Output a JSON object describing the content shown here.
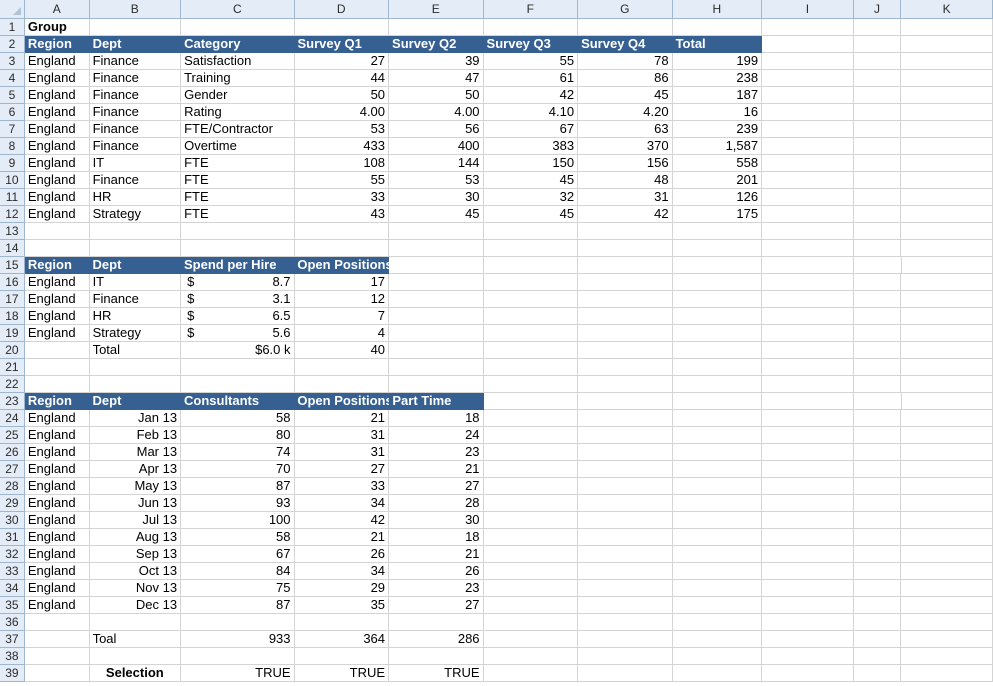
{
  "columns": [
    "A",
    "B",
    "C",
    "D",
    "E",
    "F",
    "G",
    "H",
    "I",
    "J",
    "K"
  ],
  "rows": [
    {
      "n": "1",
      "cells": [
        {
          "c": "A",
          "v": "Group",
          "cls": "bold spill"
        }
      ]
    },
    {
      "n": "2",
      "cells": [
        {
          "c": "A",
          "v": "Region",
          "cls": "th"
        },
        {
          "c": "B",
          "v": "Dept",
          "cls": "th"
        },
        {
          "c": "C",
          "v": "Category",
          "cls": "th"
        },
        {
          "c": "D",
          "v": "Survey Q1",
          "cls": "th"
        },
        {
          "c": "E",
          "v": "Survey Q2",
          "cls": "th"
        },
        {
          "c": "F",
          "v": "Survey Q3",
          "cls": "th"
        },
        {
          "c": "G",
          "v": "Survey Q4",
          "cls": "th"
        },
        {
          "c": "H",
          "v": "Total",
          "cls": "th"
        }
      ]
    },
    {
      "n": "3",
      "cells": [
        {
          "c": "A",
          "v": "England"
        },
        {
          "c": "B",
          "v": "Finance"
        },
        {
          "c": "C",
          "v": "Satisfaction"
        },
        {
          "c": "D",
          "v": "27",
          "cls": "num"
        },
        {
          "c": "E",
          "v": "39",
          "cls": "num"
        },
        {
          "c": "F",
          "v": "55",
          "cls": "num"
        },
        {
          "c": "G",
          "v": "78",
          "cls": "num"
        },
        {
          "c": "H",
          "v": "199",
          "cls": "num"
        }
      ]
    },
    {
      "n": "4",
      "cells": [
        {
          "c": "A",
          "v": "England"
        },
        {
          "c": "B",
          "v": "Finance"
        },
        {
          "c": "C",
          "v": "Training"
        },
        {
          "c": "D",
          "v": "44",
          "cls": "num"
        },
        {
          "c": "E",
          "v": "47",
          "cls": "num"
        },
        {
          "c": "F",
          "v": "61",
          "cls": "num"
        },
        {
          "c": "G",
          "v": "86",
          "cls": "num"
        },
        {
          "c": "H",
          "v": "238",
          "cls": "num"
        }
      ]
    },
    {
      "n": "5",
      "cells": [
        {
          "c": "A",
          "v": "England"
        },
        {
          "c": "B",
          "v": "Finance"
        },
        {
          "c": "C",
          "v": "Gender"
        },
        {
          "c": "D",
          "v": "50",
          "cls": "num"
        },
        {
          "c": "E",
          "v": "50",
          "cls": "num"
        },
        {
          "c": "F",
          "v": "42",
          "cls": "num"
        },
        {
          "c": "G",
          "v": "45",
          "cls": "num"
        },
        {
          "c": "H",
          "v": "187",
          "cls": "num"
        }
      ]
    },
    {
      "n": "6",
      "cells": [
        {
          "c": "A",
          "v": "England"
        },
        {
          "c": "B",
          "v": "Finance"
        },
        {
          "c": "C",
          "v": "Rating"
        },
        {
          "c": "D",
          "v": "4.00",
          "cls": "num"
        },
        {
          "c": "E",
          "v": "4.00",
          "cls": "num"
        },
        {
          "c": "F",
          "v": "4.10",
          "cls": "num"
        },
        {
          "c": "G",
          "v": "4.20",
          "cls": "num"
        },
        {
          "c": "H",
          "v": "16",
          "cls": "num"
        }
      ]
    },
    {
      "n": "7",
      "cells": [
        {
          "c": "A",
          "v": "England"
        },
        {
          "c": "B",
          "v": "Finance"
        },
        {
          "c": "C",
          "v": "FTE/Contractor"
        },
        {
          "c": "D",
          "v": "53",
          "cls": "num"
        },
        {
          "c": "E",
          "v": "56",
          "cls": "num"
        },
        {
          "c": "F",
          "v": "67",
          "cls": "num"
        },
        {
          "c": "G",
          "v": "63",
          "cls": "num"
        },
        {
          "c": "H",
          "v": "239",
          "cls": "num"
        }
      ]
    },
    {
      "n": "8",
      "cells": [
        {
          "c": "A",
          "v": "England"
        },
        {
          "c": "B",
          "v": "Finance"
        },
        {
          "c": "C",
          "v": "Overtime"
        },
        {
          "c": "D",
          "v": "433",
          "cls": "num"
        },
        {
          "c": "E",
          "v": "400",
          "cls": "num"
        },
        {
          "c": "F",
          "v": "383",
          "cls": "num"
        },
        {
          "c": "G",
          "v": "370",
          "cls": "num"
        },
        {
          "c": "H",
          "v": "1,587",
          "cls": "num"
        }
      ]
    },
    {
      "n": "9",
      "cells": [
        {
          "c": "A",
          "v": "England"
        },
        {
          "c": "B",
          "v": "IT"
        },
        {
          "c": "C",
          "v": "FTE"
        },
        {
          "c": "D",
          "v": "108",
          "cls": "num"
        },
        {
          "c": "E",
          "v": "144",
          "cls": "num"
        },
        {
          "c": "F",
          "v": "150",
          "cls": "num"
        },
        {
          "c": "G",
          "v": "156",
          "cls": "num"
        },
        {
          "c": "H",
          "v": "558",
          "cls": "num"
        }
      ]
    },
    {
      "n": "10",
      "cells": [
        {
          "c": "A",
          "v": "England"
        },
        {
          "c": "B",
          "v": "Finance"
        },
        {
          "c": "C",
          "v": "FTE"
        },
        {
          "c": "D",
          "v": "55",
          "cls": "num"
        },
        {
          "c": "E",
          "v": "53",
          "cls": "num"
        },
        {
          "c": "F",
          "v": "45",
          "cls": "num"
        },
        {
          "c": "G",
          "v": "48",
          "cls": "num"
        },
        {
          "c": "H",
          "v": "201",
          "cls": "num"
        }
      ]
    },
    {
      "n": "11",
      "cells": [
        {
          "c": "A",
          "v": "England"
        },
        {
          "c": "B",
          "v": "HR"
        },
        {
          "c": "C",
          "v": "FTE"
        },
        {
          "c": "D",
          "v": "33",
          "cls": "num"
        },
        {
          "c": "E",
          "v": "30",
          "cls": "num"
        },
        {
          "c": "F",
          "v": "32",
          "cls": "num"
        },
        {
          "c": "G",
          "v": "31",
          "cls": "num"
        },
        {
          "c": "H",
          "v": "126",
          "cls": "num"
        }
      ]
    },
    {
      "n": "12",
      "cells": [
        {
          "c": "A",
          "v": "England"
        },
        {
          "c": "B",
          "v": "Strategy"
        },
        {
          "c": "C",
          "v": "FTE"
        },
        {
          "c": "D",
          "v": "43",
          "cls": "num"
        },
        {
          "c": "E",
          "v": "45",
          "cls": "num"
        },
        {
          "c": "F",
          "v": "45",
          "cls": "num"
        },
        {
          "c": "G",
          "v": "42",
          "cls": "num"
        },
        {
          "c": "H",
          "v": "175",
          "cls": "num"
        }
      ]
    },
    {
      "n": "13",
      "cells": []
    },
    {
      "n": "14",
      "cells": []
    },
    {
      "n": "15",
      "cells": [
        {
          "c": "A",
          "v": "Region",
          "cls": "th"
        },
        {
          "c": "B",
          "v": "Dept",
          "cls": "th"
        },
        {
          "c": "C",
          "v": "Spend per Hire",
          "cls": "th"
        },
        {
          "c": "D",
          "v": "Open Positions",
          "cls": "th"
        }
      ]
    },
    {
      "n": "16",
      "cells": [
        {
          "c": "A",
          "v": "England"
        },
        {
          "c": "B",
          "v": "IT"
        },
        {
          "c": "C",
          "v": "8.7",
          "cls": "num",
          "dollar": "$"
        },
        {
          "c": "D",
          "v": "17",
          "cls": "num"
        }
      ]
    },
    {
      "n": "17",
      "cells": [
        {
          "c": "A",
          "v": "England"
        },
        {
          "c": "B",
          "v": "Finance"
        },
        {
          "c": "C",
          "v": "3.1",
          "cls": "num",
          "dollar": "$"
        },
        {
          "c": "D",
          "v": "12",
          "cls": "num"
        }
      ]
    },
    {
      "n": "18",
      "cells": [
        {
          "c": "A",
          "v": "England"
        },
        {
          "c": "B",
          "v": "HR"
        },
        {
          "c": "C",
          "v": "6.5",
          "cls": "num",
          "dollar": "$"
        },
        {
          "c": "D",
          "v": "7",
          "cls": "num"
        }
      ]
    },
    {
      "n": "19",
      "cells": [
        {
          "c": "A",
          "v": "England"
        },
        {
          "c": "B",
          "v": "Strategy"
        },
        {
          "c": "C",
          "v": "5.6",
          "cls": "num",
          "dollar": "$"
        },
        {
          "c": "D",
          "v": "4",
          "cls": "num"
        }
      ]
    },
    {
      "n": "20",
      "cells": [
        {
          "c": "B",
          "v": "Total"
        },
        {
          "c": "C",
          "v": "$6.0 k",
          "cls": "num"
        },
        {
          "c": "D",
          "v": "40",
          "cls": "num"
        }
      ]
    },
    {
      "n": "21",
      "cells": []
    },
    {
      "n": "22",
      "cells": []
    },
    {
      "n": "23",
      "cells": [
        {
          "c": "A",
          "v": "Region",
          "cls": "th"
        },
        {
          "c": "B",
          "v": "Dept",
          "cls": "th"
        },
        {
          "c": "C",
          "v": "Consultants",
          "cls": "th"
        },
        {
          "c": "D",
          "v": "Open Positions",
          "cls": "th"
        },
        {
          "c": "E",
          "v": "Part Time",
          "cls": "th"
        }
      ]
    },
    {
      "n": "24",
      "cells": [
        {
          "c": "A",
          "v": "England"
        },
        {
          "c": "B",
          "v": "Jan 13",
          "cls": "num"
        },
        {
          "c": "C",
          "v": "58",
          "cls": "num"
        },
        {
          "c": "D",
          "v": "21",
          "cls": "num"
        },
        {
          "c": "E",
          "v": "18",
          "cls": "num"
        }
      ]
    },
    {
      "n": "25",
      "cells": [
        {
          "c": "A",
          "v": "England"
        },
        {
          "c": "B",
          "v": "Feb 13",
          "cls": "num"
        },
        {
          "c": "C",
          "v": "80",
          "cls": "num"
        },
        {
          "c": "D",
          "v": "31",
          "cls": "num"
        },
        {
          "c": "E",
          "v": "24",
          "cls": "num"
        }
      ]
    },
    {
      "n": "26",
      "cells": [
        {
          "c": "A",
          "v": "England"
        },
        {
          "c": "B",
          "v": "Mar 13",
          "cls": "num"
        },
        {
          "c": "C",
          "v": "74",
          "cls": "num"
        },
        {
          "c": "D",
          "v": "31",
          "cls": "num"
        },
        {
          "c": "E",
          "v": "23",
          "cls": "num"
        }
      ]
    },
    {
      "n": "27",
      "cells": [
        {
          "c": "A",
          "v": "England"
        },
        {
          "c": "B",
          "v": "Apr 13",
          "cls": "num"
        },
        {
          "c": "C",
          "v": "70",
          "cls": "num"
        },
        {
          "c": "D",
          "v": "27",
          "cls": "num"
        },
        {
          "c": "E",
          "v": "21",
          "cls": "num"
        }
      ]
    },
    {
      "n": "28",
      "cells": [
        {
          "c": "A",
          "v": "England"
        },
        {
          "c": "B",
          "v": "May 13",
          "cls": "num"
        },
        {
          "c": "C",
          "v": "87",
          "cls": "num"
        },
        {
          "c": "D",
          "v": "33",
          "cls": "num"
        },
        {
          "c": "E",
          "v": "27",
          "cls": "num"
        }
      ]
    },
    {
      "n": "29",
      "cells": [
        {
          "c": "A",
          "v": "England"
        },
        {
          "c": "B",
          "v": "Jun 13",
          "cls": "num"
        },
        {
          "c": "C",
          "v": "93",
          "cls": "num"
        },
        {
          "c": "D",
          "v": "34",
          "cls": "num"
        },
        {
          "c": "E",
          "v": "28",
          "cls": "num"
        }
      ]
    },
    {
      "n": "30",
      "cells": [
        {
          "c": "A",
          "v": "England"
        },
        {
          "c": "B",
          "v": "Jul 13",
          "cls": "num"
        },
        {
          "c": "C",
          "v": "100",
          "cls": "num"
        },
        {
          "c": "D",
          "v": "42",
          "cls": "num"
        },
        {
          "c": "E",
          "v": "30",
          "cls": "num"
        }
      ]
    },
    {
      "n": "31",
      "cells": [
        {
          "c": "A",
          "v": "England"
        },
        {
          "c": "B",
          "v": "Aug 13",
          "cls": "num"
        },
        {
          "c": "C",
          "v": "58",
          "cls": "num"
        },
        {
          "c": "D",
          "v": "21",
          "cls": "num"
        },
        {
          "c": "E",
          "v": "18",
          "cls": "num"
        }
      ]
    },
    {
      "n": "32",
      "cells": [
        {
          "c": "A",
          "v": "England"
        },
        {
          "c": "B",
          "v": "Sep 13",
          "cls": "num"
        },
        {
          "c": "C",
          "v": "67",
          "cls": "num"
        },
        {
          "c": "D",
          "v": "26",
          "cls": "num"
        },
        {
          "c": "E",
          "v": "21",
          "cls": "num"
        }
      ]
    },
    {
      "n": "33",
      "cells": [
        {
          "c": "A",
          "v": "England"
        },
        {
          "c": "B",
          "v": "Oct 13",
          "cls": "num"
        },
        {
          "c": "C",
          "v": "84",
          "cls": "num"
        },
        {
          "c": "D",
          "v": "34",
          "cls": "num"
        },
        {
          "c": "E",
          "v": "26",
          "cls": "num"
        }
      ]
    },
    {
      "n": "34",
      "cells": [
        {
          "c": "A",
          "v": "England"
        },
        {
          "c": "B",
          "v": "Nov 13",
          "cls": "num"
        },
        {
          "c": "C",
          "v": "75",
          "cls": "num"
        },
        {
          "c": "D",
          "v": "29",
          "cls": "num"
        },
        {
          "c": "E",
          "v": "23",
          "cls": "num"
        }
      ]
    },
    {
      "n": "35",
      "cells": [
        {
          "c": "A",
          "v": "England"
        },
        {
          "c": "B",
          "v": "Dec 13",
          "cls": "num"
        },
        {
          "c": "C",
          "v": "87",
          "cls": "num"
        },
        {
          "c": "D",
          "v": "35",
          "cls": "num"
        },
        {
          "c": "E",
          "v": "27",
          "cls": "num"
        }
      ]
    },
    {
      "n": "36",
      "cells": []
    },
    {
      "n": "37",
      "cells": [
        {
          "c": "B",
          "v": "Toal"
        },
        {
          "c": "C",
          "v": "933",
          "cls": "num"
        },
        {
          "c": "D",
          "v": "364",
          "cls": "num"
        },
        {
          "c": "E",
          "v": "286",
          "cls": "num"
        }
      ]
    },
    {
      "n": "38",
      "cells": []
    },
    {
      "n": "39",
      "cells": [
        {
          "c": "B",
          "v": "Selection",
          "cls": "bold ctr"
        },
        {
          "c": "C",
          "v": "TRUE",
          "cls": "num"
        },
        {
          "c": "D",
          "v": "TRUE",
          "cls": "num"
        },
        {
          "c": "E",
          "v": "TRUE",
          "cls": "num"
        }
      ]
    }
  ],
  "colors": {
    "header_fill": "#366092",
    "header_text": "#ffffff",
    "gridline": "#d4d4d4",
    "heading_bg": "#e4ecf7"
  }
}
